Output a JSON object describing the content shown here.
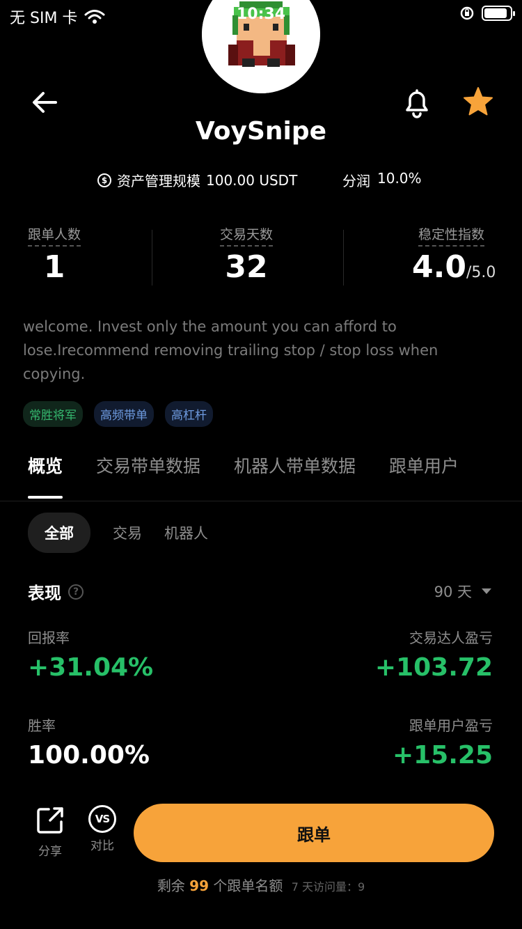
{
  "status_bar": {
    "carrier": "无 SIM 卡",
    "time": "10:34",
    "battery_level": 0.9
  },
  "trader": {
    "name": "VoySnipe",
    "aum_label": "资产管理规模",
    "aum_value": "100.00 USDT",
    "profit_share_label": "分润",
    "profit_share_value": "10.0%",
    "aum_icon": "$"
  },
  "stats": {
    "followers_label": "跟单人数",
    "followers_value": "1",
    "days_label": "交易天数",
    "days_value": "32",
    "stability_label": "稳定性指数",
    "stability_value": "4.0",
    "stability_max": "/5.0"
  },
  "description": "welcome. Invest only the amount you can afford to lose.Irecommend removing trailing stop / stop loss when copying.",
  "tags": [
    "常胜将军",
    "高频带单",
    "高杠杆"
  ],
  "tabs": [
    "概览",
    "交易带单数据",
    "机器人带单数据",
    "跟单用户"
  ],
  "subtabs": [
    "全部",
    "交易",
    "机器人"
  ],
  "performance": {
    "title": "表现",
    "help": "?",
    "period": "90 天",
    "roi_label": "回报率",
    "roi_value": "+31.04%",
    "trader_pnl_label": "交易达人盈亏",
    "trader_pnl_value": "+103.72",
    "win_rate_label": "胜率",
    "win_rate_value": "100.00%",
    "copier_pnl_label": "跟单用户盈亏",
    "copier_pnl_value": "+15.25"
  },
  "actions": {
    "share_label": "分享",
    "compare_label": "对比",
    "compare_icon": "VS",
    "copy_label": "跟单"
  },
  "quota": {
    "prefix": "剩余",
    "count": "99",
    "suffix": "个跟单名额",
    "visits": "7 天访问量：9"
  },
  "colors": {
    "accent": "#f7a33a",
    "positive": "#27c068",
    "star": "#f7a33a"
  }
}
